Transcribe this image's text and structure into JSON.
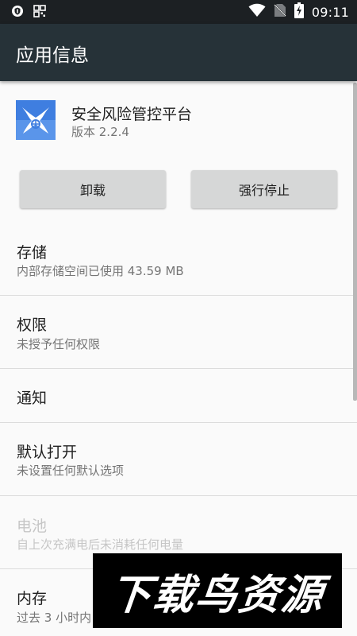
{
  "status_bar": {
    "time": "09:11"
  },
  "app_bar": {
    "title": "应用信息"
  },
  "app": {
    "name": "安全风险管控平台",
    "version": "版本 2.2.4"
  },
  "buttons": {
    "uninstall": "卸载",
    "force_stop": "强行停止"
  },
  "prefs": {
    "storage": {
      "title": "存储",
      "summary": "内部存储空间已使用 43.59 MB"
    },
    "permissions": {
      "title": "权限",
      "summary": "未授予任何权限"
    },
    "notifications": {
      "title": "通知"
    },
    "open_by_default": {
      "title": "默认打开",
      "summary": "未设置任何默认选项"
    },
    "battery": {
      "title": "电池",
      "summary": "自上次充满电后未消耗任何电量"
    },
    "memory": {
      "title": "内存",
      "summary": "过去 3 小时内"
    }
  },
  "watermark": {
    "text": "下载鸟资源"
  },
  "colors": {
    "status_bar": "#1c2023",
    "app_bar": "#263238",
    "background": "#fafafa",
    "button": "#d6d7d7"
  },
  "icons": [
    "shield-icon",
    "qr-code-icon",
    "wifi-icon",
    "no-sim-icon",
    "battery-charging-icon",
    "app-logo-icon"
  ]
}
